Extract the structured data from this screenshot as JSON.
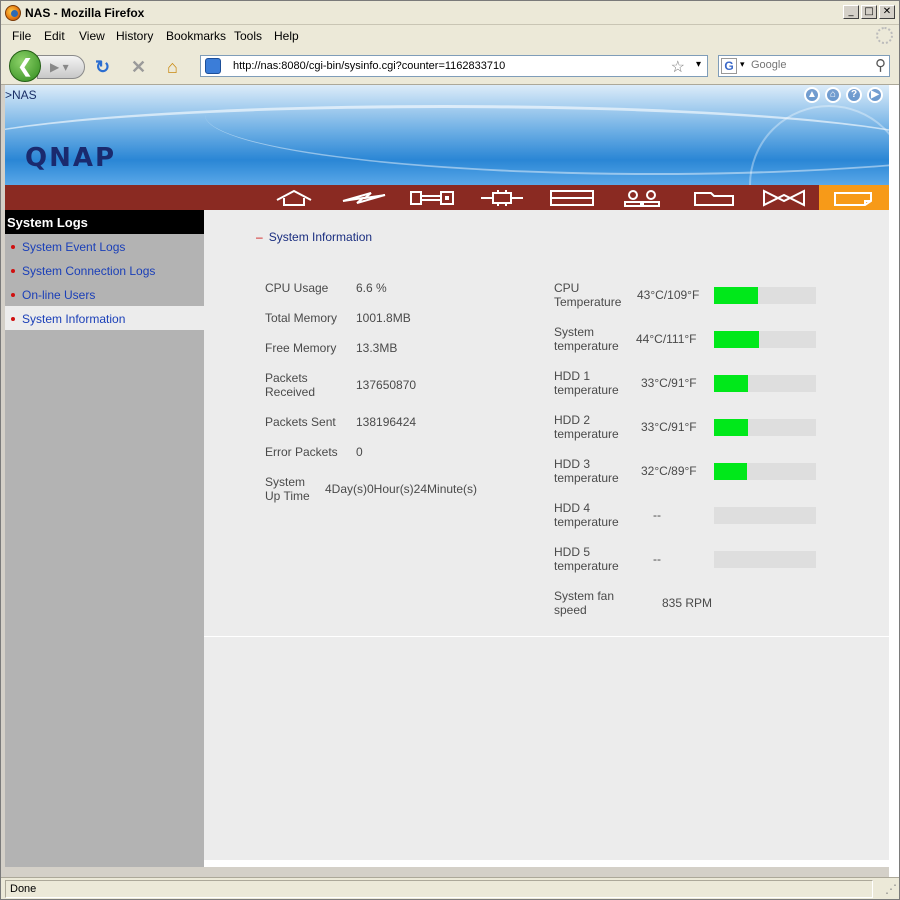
{
  "window": {
    "title": "NAS - Mozilla Firefox"
  },
  "menu": [
    "File",
    "Edit",
    "View",
    "History",
    "Bookmarks",
    "Tools",
    "Help"
  ],
  "toolbar": {
    "url": "http://nas:8080/cgi-bin/sysinfo.cgi?counter=1162833710",
    "search_placeholder": "Google"
  },
  "banner": {
    "breadcrumb": ">NAS",
    "logo": "QNAP"
  },
  "sidebar": {
    "heading": "System Logs",
    "items": [
      "System Event Logs",
      "System Connection Logs",
      "On-line Users",
      "System Information"
    ]
  },
  "main": {
    "section_title": "System Information",
    "left": [
      {
        "label": "CPU Usage",
        "value": "6.6 %"
      },
      {
        "label": "Total Memory",
        "value": "1001.8MB"
      },
      {
        "label": "Free Memory",
        "value": "13.3MB"
      },
      {
        "label": "Packets\nReceived",
        "value": "137650870"
      },
      {
        "label": "Packets Sent",
        "value": "138196424"
      },
      {
        "label": "Error Packets",
        "value": "0"
      },
      {
        "label": "System\nUp Time",
        "value": "4Day(s)0Hour(s)24Minute(s)"
      }
    ],
    "right": [
      {
        "label": "CPU\nTemperature",
        "value": "43°C/109°F",
        "level": 0.43
      },
      {
        "label": "System\ntemperature",
        "value": "44°C/111°F",
        "level": 0.44
      },
      {
        "label": "HDD 1\ntemperature",
        "value": "33°C/91°F",
        "level": 0.33
      },
      {
        "label": "HDD 2\ntemperature",
        "value": "33°C/91°F",
        "level": 0.33
      },
      {
        "label": "HDD 3\ntemperature",
        "value": "32°C/89°F",
        "level": 0.32
      },
      {
        "label": "HDD 4\ntemperature",
        "value": "--",
        "level": 0
      },
      {
        "label": "HDD 5\ntemperature",
        "value": "--",
        "level": 0
      },
      {
        "label": "System fan\nspeed",
        "value": "835 RPM"
      }
    ]
  },
  "status": {
    "text": "Done"
  },
  "colors": {
    "nav_bar": "#8a2a22",
    "nav_active": "#f79a18",
    "temp_fill": "#00e81a",
    "link": "#1a3fb8"
  }
}
